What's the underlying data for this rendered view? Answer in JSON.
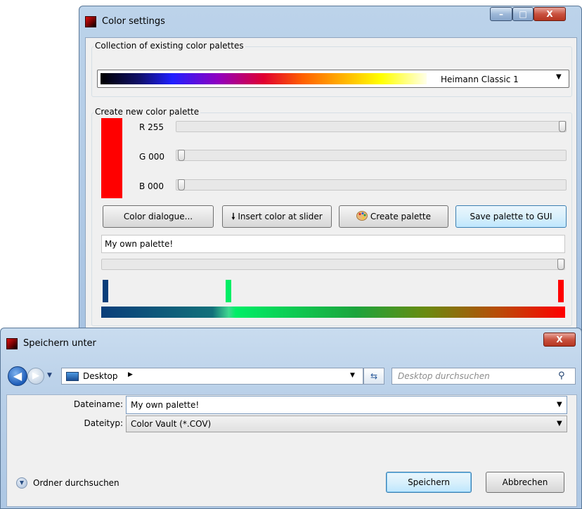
{
  "color_settings": {
    "title": "Color settings",
    "caption_buttons": {
      "minimize": "–",
      "maximize": "□",
      "close": "X"
    },
    "existing_group": {
      "label": "Collection of existing color palettes",
      "selected_palette": "Heimann Classic 1",
      "dropdown_arrow": "▼"
    },
    "new_group": {
      "label": "Create new color palette",
      "swatch_color": "#ff0000",
      "sliders": [
        {
          "label": "R 255",
          "value": 255,
          "max": 255
        },
        {
          "label": "G 000",
          "value": 0,
          "max": 255
        },
        {
          "label": "B 000",
          "value": 0,
          "max": 255
        }
      ],
      "buttons": {
        "color_dialogue": "Color dialogue...",
        "insert_color": "Insert color at slider",
        "create_palette": "Create palette",
        "save_palette": "Save palette to GUI"
      },
      "palette_name": "My own palette!",
      "position_slider_fraction": 1.0,
      "color_stops": [
        {
          "color": "#0a3e7a",
          "position": 0.0
        },
        {
          "color": "#00ee66",
          "position": 0.27
        },
        {
          "color": "#ff0000",
          "position": 1.0
        }
      ]
    }
  },
  "save_dialog": {
    "title": "Speichern unter",
    "close_label": "X",
    "address": {
      "location": "Desktop",
      "chevron": "▶",
      "drop": "▼"
    },
    "search_placeholder": "Desktop durchsuchen",
    "file_name_label": "Dateiname:",
    "file_name_value": "My own palette!",
    "file_type_label": "Dateityp:",
    "file_type_value": "Color Vault (*.COV)",
    "browse_folders": "Ordner durchsuchen",
    "save_button": "Speichern",
    "cancel_button": "Abbrechen"
  },
  "icons": {
    "app": "app-icon",
    "insert": "down-arrow-icon",
    "create": "palette-icon",
    "back": "back-arrow-icon",
    "forward": "forward-arrow-icon",
    "search": "search-icon",
    "refresh": "refresh-icon"
  }
}
